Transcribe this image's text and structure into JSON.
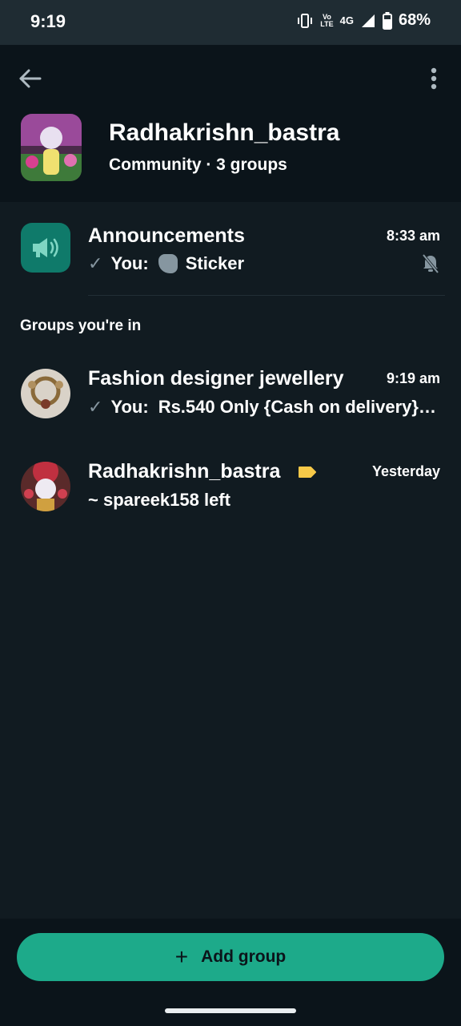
{
  "status_bar": {
    "time": "9:19",
    "network_top": "Vo",
    "network_bottom": "LTE",
    "network_type": "4G",
    "battery": "68%"
  },
  "header": {
    "community_name": "Radhakrishn_bastra",
    "community_meta": "Community · 3 groups",
    "icons": [
      "back-arrow-icon",
      "more-vert-icon"
    ]
  },
  "announcements": {
    "title": "Announcements",
    "time": "8:33 am",
    "sender": "You:",
    "message": "Sticker"
  },
  "section_label": "Groups you're in",
  "groups": [
    {
      "title": "Fashion designer jewellery",
      "time": "9:19 am",
      "sender": "You:",
      "message": "Rs.540 Only {Cash on delivery}…"
    },
    {
      "title": "Radhakrishn_bastra",
      "time": "Yesterday",
      "message": "~ spareek158 left"
    }
  ],
  "add_group_label": "Add group",
  "colors": {
    "accent": "#1daa8a",
    "background": "#111b21",
    "header": "#0b141a",
    "announcement_icon": "#0f7a6a",
    "tag": "#f7c948"
  }
}
